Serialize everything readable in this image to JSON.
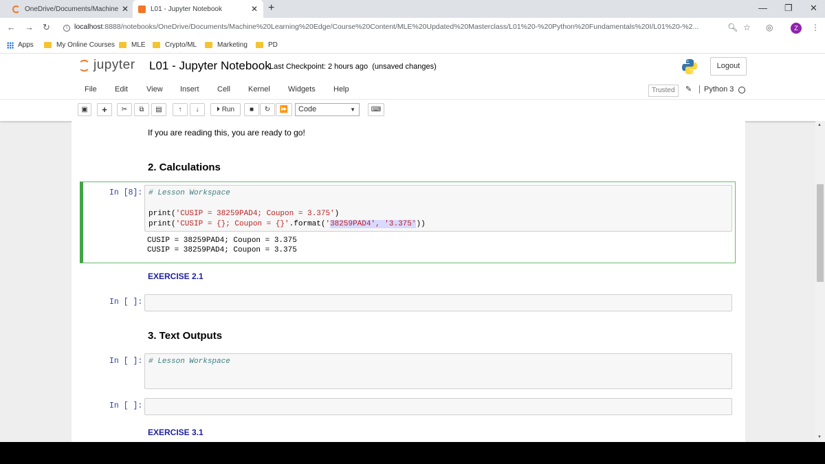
{
  "browser": {
    "tabs": [
      {
        "title": "OneDrive/Documents/Machine L",
        "active": false
      },
      {
        "title": "L01 - Jupyter Notebook",
        "active": true
      }
    ],
    "url_host": "localhost",
    "url_path": ":8888/notebooks/OneDrive/Documents/Machine%20Learning%20Edge/Course%20Content/MLE%20Updated%20Masterclass/L01%20-%20Python%20Fundamentals%20I/L01%20-%2...",
    "profile_initial": "Z",
    "bookmarks": [
      "Apps",
      "My Online Courses",
      "MLE",
      "Crypto/ML",
      "Marketing",
      "PD"
    ]
  },
  "jupyter": {
    "logo_text": "jupyter",
    "notebook_name": "L01 - Jupyter Notebook",
    "checkpoint_label": "Last Checkpoint:",
    "checkpoint_time": "2 hours ago",
    "unsaved": "(unsaved changes)",
    "logout": "Logout",
    "menus": [
      "File",
      "Edit",
      "View",
      "Insert",
      "Cell",
      "Kernel",
      "Widgets",
      "Help"
    ],
    "trusted": "Trusted",
    "kernel_name": "Python 3",
    "toolbar": {
      "run_label": "Run",
      "cell_type": "Code"
    }
  },
  "notebook": {
    "intro_text": "If you are reading this, you are ready to go!",
    "heading_calc": "2. Calculations",
    "cell1": {
      "prompt": "In [8]:",
      "comment": "# Lesson Workspace",
      "line1_fn": "print(",
      "line1_str": "'CUSIP = 38259PAD4; Coupon = 3.375'",
      "line1_end": ")",
      "line2_fn": "print(",
      "line2_str": "'CUSIP = {}; Coupon = {}'",
      "line2_mid": ".format(",
      "line2_arg1_q": "'",
      "line2_arg1_sel": "38259PAD4', '3.375'",
      "line2_end": "))",
      "output": [
        "CUSIP = 38259PAD4; Coupon = 3.375",
        "CUSIP = 38259PAD4; Coupon = 3.375"
      ]
    },
    "exercise_21": "EXERCISE 2.1",
    "cell2_prompt": "In [ ]:",
    "heading_text": "3. Text Outputs",
    "cell3_prompt": "In [ ]:",
    "cell3_comment": "# Lesson Workspace",
    "cell4_prompt": "In [ ]:",
    "exercise_31": "EXERCISE 3.1"
  }
}
